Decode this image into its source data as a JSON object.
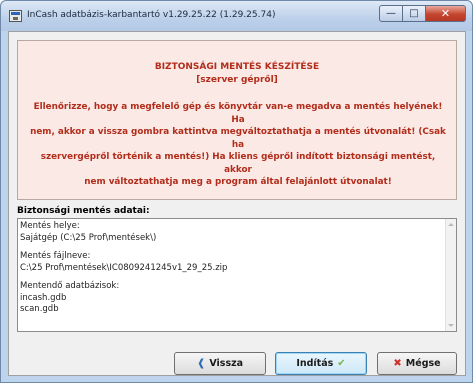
{
  "window": {
    "title": "InCash adatbázis-karbantartó v1.29.25.22 (1.29.25.74)"
  },
  "warning": {
    "title": "BIZTONSÁGI MENTÉS KÉSZÍTÉSE",
    "subtitle": "[szerver gépről]",
    "line1": "Ellenőrizze, hogy a megfelelő gép és könyvtár van-e megadva a mentés helyének! Ha",
    "line2": "nem, akkor a vissza gombra kattintva megváltoztathatja a mentés útvonalát! (Csak ha",
    "line3": "szervergépről történik a mentés!) Ha kliens gépről indított biztonsági mentést, akkor",
    "line4": "nem változtathatja meg a program által felajánlott útvonalat!",
    "color": "#b22c1a"
  },
  "backup_data": {
    "header": "Biztonsági mentés adatai:",
    "location_label": "Mentés helye:",
    "location_value": "Sajátgép (C:\\25 Prof\\mentések\\)",
    "filename_label": "Mentés fájlneve:",
    "filename_value": "C:\\25 Prof\\mentések\\IC0809241245v1_29_25.zip",
    "databases_label": "Mentendő adatbázisok:",
    "databases": [
      "incash.gdb",
      "scan.gdb"
    ]
  },
  "buttons": {
    "back_label": "Vissza",
    "start_label": "Indítás",
    "cancel_label": "Mégse"
  },
  "icons": {
    "back": "arrow-left-icon",
    "start": "checkmark-arrow-icon",
    "cancel": "x-icon"
  }
}
